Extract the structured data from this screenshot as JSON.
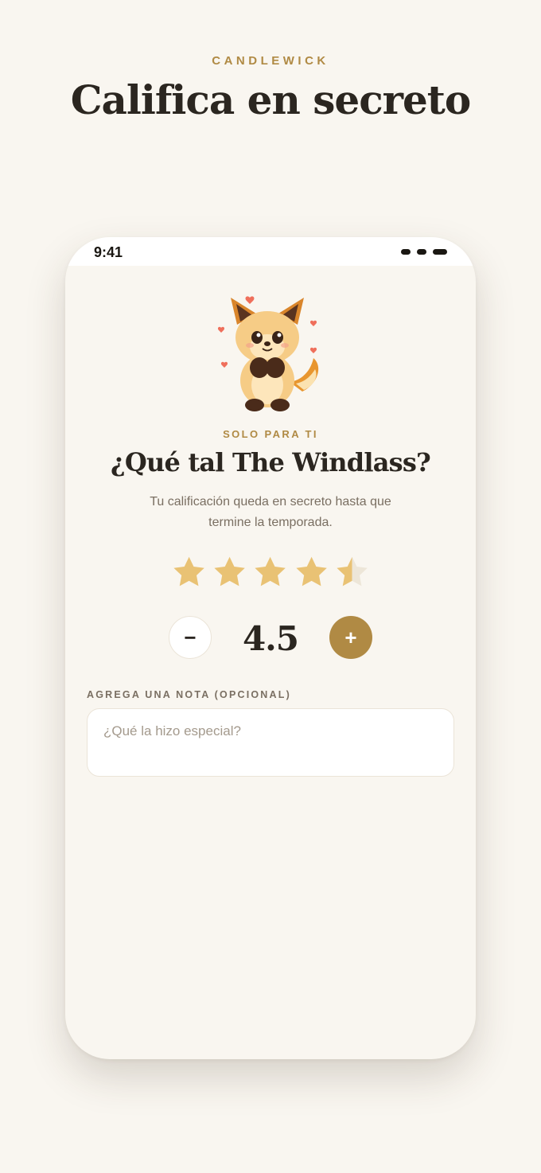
{
  "page": {
    "brand": "CANDLEWICK",
    "headline": "Califica en secreto"
  },
  "status_bar": {
    "time": "9:41"
  },
  "screen": {
    "eyebrow": "SOLO PARA TI",
    "question": "¿Qué tal The Windlass?",
    "subtitle": "Tu calificación queda en secreto hasta que termine la temporada."
  },
  "rating": {
    "value": 4.5,
    "display": "4.5",
    "max": 5,
    "minus_label": "−",
    "plus_label": "+"
  },
  "note": {
    "label": "AGREGA UNA NOTA (OPCIONAL)",
    "value": "",
    "placeholder": "¿Qué la hizo especial?"
  },
  "icons": {
    "mascot": "fox-mascot-icon",
    "star": "star-icon",
    "minus": "minus-icon",
    "plus": "plus-icon"
  },
  "colors": {
    "background": "#f9f6f0",
    "accent": "#b08a44",
    "star_filled": "#e9c274",
    "star_empty": "#ede6d8",
    "heading": "#2b2620",
    "muted": "#7a6f62"
  }
}
